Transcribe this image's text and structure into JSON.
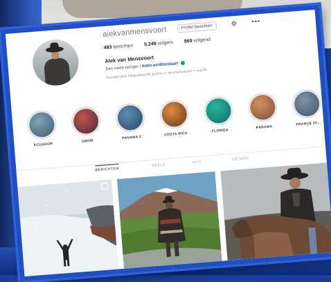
{
  "profile": {
    "username": "aiekvanmensvoort",
    "edit_label": "Profiel bewerken",
    "stats": [
      {
        "value": "493",
        "label": "berichten"
      },
      {
        "value": "5.249",
        "label": "volgers"
      },
      {
        "value": "869",
        "label": "volgend"
      }
    ],
    "full_name": "Alek van Mensvoort",
    "bio_text": "Een vaste reiziger |",
    "bio_link": "linktr.ee/40mstaar!",
    "followed_by": "Gevolgd door fotografieworld, justine.nl, lara.backpacker + nog 96"
  },
  "highlights": [
    {
      "label": "ECUADOR",
      "colors": [
        "#7fa3b7",
        "#3b5a6f"
      ]
    },
    {
      "label": "SNOW",
      "colors": [
        "#c4534a",
        "#3c2b3d"
      ]
    },
    {
      "label": "PANAMA 2",
      "colors": [
        "#5f8fb4",
        "#22445e"
      ]
    },
    {
      "label": "COSTA RICA",
      "colors": [
        "#e48a3a",
        "#5a3824"
      ]
    },
    {
      "label": "FLORIDA",
      "colors": [
        "#28b49a",
        "#0d6d6a"
      ]
    },
    {
      "label": "PANAMA",
      "colors": [
        "#d9905b",
        "#6d4f3b"
      ]
    },
    {
      "label": "FRANCE 20...",
      "colors": [
        "#7d96a8",
        "#3e4f60"
      ]
    }
  ],
  "tabs": [
    "BERICHTEN",
    "REELS",
    "IGTV",
    "GETAGD"
  ],
  "posts": [
    {
      "name": "post-snow-arms-raised"
    },
    {
      "name": "post-poncho-mountain"
    },
    {
      "name": "post-cowboy-horse"
    }
  ]
}
